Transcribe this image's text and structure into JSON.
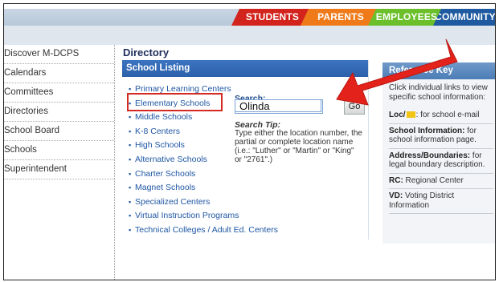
{
  "top_nav": {
    "tabs": [
      {
        "label": "STUDENTS",
        "color": "#d2231d"
      },
      {
        "label": "PARENTS",
        "color": "#ef7a1a"
      },
      {
        "label": "EMPLOYEES",
        "color": "#6abf2a"
      },
      {
        "label": "COMMUNITY",
        "color": "#1f5aa0"
      }
    ]
  },
  "sidebar": {
    "items": [
      {
        "label": "Discover M-DCPS"
      },
      {
        "label": "Calendars"
      },
      {
        "label": "Committees"
      },
      {
        "label": "Directories"
      },
      {
        "label": "School Board"
      },
      {
        "label": "Schools"
      },
      {
        "label": "Superintendent"
      }
    ]
  },
  "main": {
    "title": "Directory",
    "listing_title": "School Listing",
    "links": [
      "Primary Learning Centers",
      "Elementary Schools",
      "Middle Schools",
      "K-8 Centers",
      "High Schools",
      "Alternative Schools",
      "Charter Schools",
      "Magnet Schools",
      "Specialized Centers",
      "Virtual Instruction Programs",
      "Technical Colleges / Adult Ed. Centers"
    ],
    "search": {
      "label": "Search:",
      "value": "Olinda",
      "button": "Go"
    },
    "tip": {
      "title": "Search Tip:",
      "text": "Type either the location number, the partial or complete location name (i.e.: \"Luther\" or \"Martin\" or \"King\" or \"2761\".)"
    }
  },
  "reference_key": {
    "title": "Reference Key",
    "intro": "Click individual links to view specific school information:",
    "rows": [
      {
        "term": "Loc/",
        "after_icon": ":",
        "desc": " for school e-mail"
      },
      {
        "term": "School Information:",
        "desc": " for school information page."
      },
      {
        "term": "Address/Boundaries:",
        "desc": " for legal boundary description."
      },
      {
        "term": "RC:",
        "desc": " Regional Center"
      },
      {
        "term": "VD:",
        "desc": " Voting District Information"
      }
    ]
  },
  "colors": {
    "accent_blue": "#2c60a9",
    "highlight_red": "#d52a22"
  }
}
